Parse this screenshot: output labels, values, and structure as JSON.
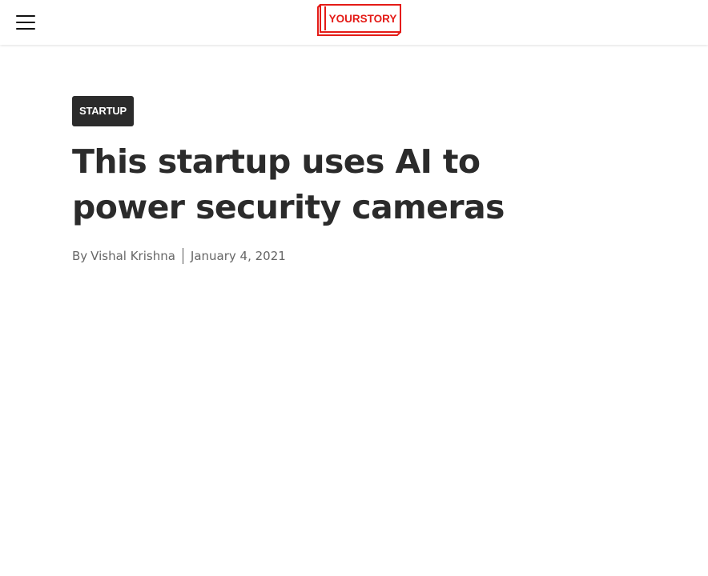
{
  "header": {
    "menu_icon": "hamburger-menu-icon",
    "logo_text": "YOURSTORY",
    "brand_color": "#e41b17"
  },
  "article": {
    "category": "STARTUP",
    "headline": "This startup uses AI to power security cameras",
    "byline_prefix": "By",
    "author": "Vishal Krishna",
    "date": "January 4, 2021"
  },
  "colors": {
    "badge_bg": "#2b2b2b",
    "headline": "#2b2b2b",
    "meta": "#666666"
  }
}
